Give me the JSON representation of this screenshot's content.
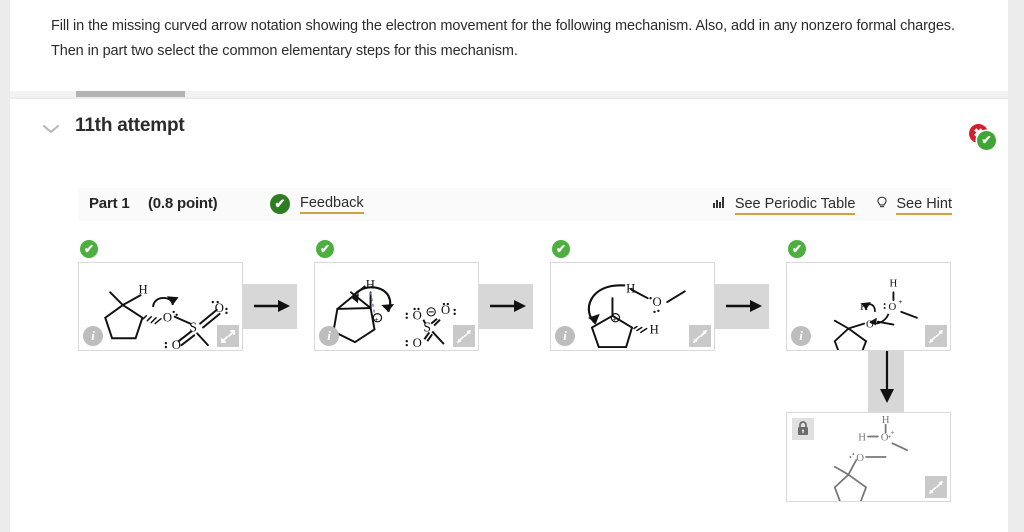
{
  "question": {
    "line1": "Fill in the missing curved arrow notation showing the electron movement for the following mechanism. Also, add in any nonzero formal charges.",
    "line2": "Then in part two select the common elementary steps for this mechanism."
  },
  "attempt": {
    "chevron_glyph": "ⱟ",
    "title": "11th attempt",
    "status_incorrect_glyph": "✖",
    "status_correct_glyph": "✔"
  },
  "part": {
    "label": "Part 1",
    "points": "(0.8 point)",
    "feedback_check_glyph": "✔",
    "feedback_label": "Feedback",
    "periodic_table_label": "See Periodic Table",
    "periodic_table_icon": "bar-chart-icon",
    "hint_label": "See Hint",
    "hint_icon": "lightbulb-icon"
  },
  "panels": [
    {
      "id": "step-1",
      "status": "correct",
      "status_glyph": "✔",
      "info_glyph": "i",
      "expand_icon": "expand-arrows-icon",
      "locked": false,
      "atom_labels": [
        "H",
        "O",
        "O",
        "S",
        "O"
      ]
    },
    {
      "id": "step-2",
      "status": "correct",
      "status_glyph": "✔",
      "info_glyph": "i",
      "expand_icon": "expand-arrows-icon",
      "locked": false,
      "atom_labels": [
        "H",
        "O",
        "O",
        "S",
        "O"
      ]
    },
    {
      "id": "step-3",
      "status": "correct",
      "status_glyph": "✔",
      "info_glyph": "i",
      "expand_icon": "expand-arrows-icon",
      "locked": false,
      "atom_labels": [
        "H",
        "O",
        "H"
      ]
    },
    {
      "id": "step-4",
      "status": "correct",
      "status_glyph": "✔",
      "info_glyph": "i",
      "expand_icon": "expand-arrows-icon",
      "locked": false,
      "atom_labels": [
        "H",
        "H",
        "O",
        "O"
      ]
    },
    {
      "id": "step-5",
      "status": "locked",
      "info_glyph": "",
      "expand_icon": "expand-arrows-icon",
      "locked": true,
      "lock_icon": "lock-icon",
      "atom_labels": [
        "H",
        "H",
        "O",
        "O"
      ]
    }
  ],
  "connectors": {
    "horizontal_arrow_glyph": "→",
    "vertical_arrow_glyph": "↓"
  },
  "colors": {
    "page_bg": "#ececec",
    "card_bg": "#ffffff",
    "accent_underline": "#cba43c",
    "correct_green": "#4caf3f",
    "feedback_green": "#2e7d22",
    "incorrect_red": "#cf2030",
    "band_gray": "#d7d7d7",
    "panel_border": "#d9d9d9",
    "part_band_bg": "#fafafa",
    "progress_fill": "#b3b3b3"
  }
}
